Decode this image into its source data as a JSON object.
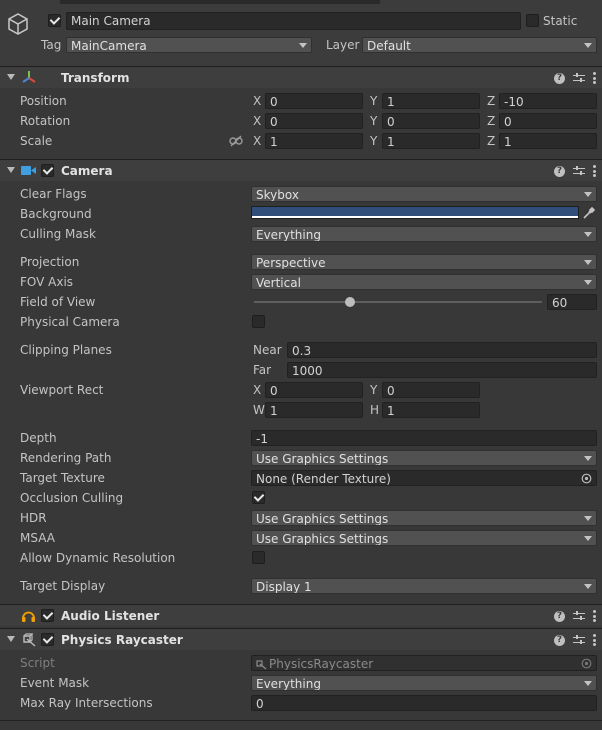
{
  "header": {
    "name": "Main Camera",
    "static_label": "Static",
    "tag_label": "Tag",
    "tag_value": "MainCamera",
    "layer_label": "Layer",
    "layer_value": "Default"
  },
  "transform": {
    "title": "Transform",
    "position_label": "Position",
    "rotation_label": "Rotation",
    "scale_label": "Scale",
    "x": "X",
    "y": "Y",
    "z": "Z",
    "position": [
      "0",
      "1",
      "-10"
    ],
    "rotation": [
      "0",
      "0",
      "0"
    ],
    "scale": [
      "1",
      "1",
      "1"
    ]
  },
  "camera": {
    "title": "Camera",
    "clear_flags_label": "Clear Flags",
    "clear_flags_value": "Skybox",
    "background_label": "Background",
    "background_color": "#314d79",
    "culling_mask_label": "Culling Mask",
    "culling_mask_value": "Everything",
    "projection_label": "Projection",
    "projection_value": "Perspective",
    "fov_axis_label": "FOV Axis",
    "fov_axis_value": "Vertical",
    "fov_label": "Field of View",
    "fov_value": "60",
    "fov_fraction": 0.333,
    "physical_label": "Physical Camera",
    "clipping_label": "Clipping Planes",
    "near_label": "Near",
    "near_value": "0.3",
    "far_label": "Far",
    "far_value": "1000",
    "viewport_label": "Viewport Rect",
    "vx_label": "X",
    "vx_value": "0",
    "vy_label": "Y",
    "vy_value": "0",
    "vw_label": "W",
    "vw_value": "1",
    "vh_label": "H",
    "vh_value": "1",
    "depth_label": "Depth",
    "depth_value": "-1",
    "rendering_path_label": "Rendering Path",
    "rendering_path_value": "Use Graphics Settings",
    "target_texture_label": "Target Texture",
    "target_texture_value": "None (Render Texture)",
    "occlusion_label": "Occlusion Culling",
    "hdr_label": "HDR",
    "hdr_value": "Use Graphics Settings",
    "msaa_label": "MSAA",
    "msaa_value": "Use Graphics Settings",
    "dynres_label": "Allow Dynamic Resolution",
    "target_display_label": "Target Display",
    "target_display_value": "Display 1"
  },
  "audio_listener": {
    "title": "Audio Listener"
  },
  "physics_raycaster": {
    "title": "Physics Raycaster",
    "script_label": "Script",
    "script_value": "PhysicsRaycaster",
    "event_mask_label": "Event Mask",
    "event_mask_value": "Everything",
    "max_ray_label": "Max Ray Intersections",
    "max_ray_value": "0"
  },
  "icons": {
    "help": "?",
    "gameobject": "cube-icon",
    "transform": "transform-axes-icon",
    "camera": "camera-icon",
    "audio": "headphones-icon",
    "raycaster": "raycaster-icon"
  }
}
